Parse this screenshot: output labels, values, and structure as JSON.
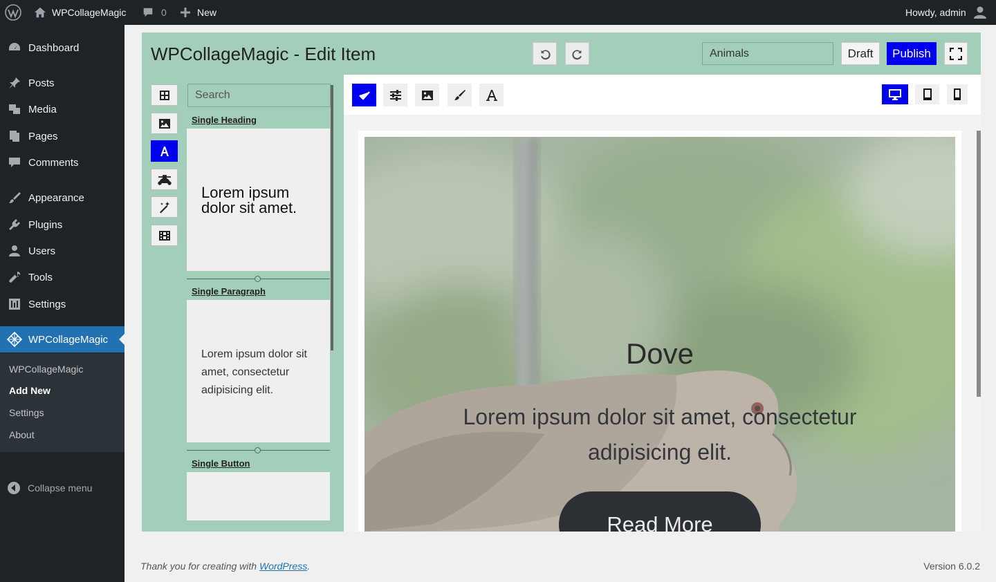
{
  "adminbar": {
    "site_name": "WPCollageMagic",
    "comments_count": "0",
    "new_label": "New",
    "greeting": "Howdy, admin"
  },
  "sidebar": {
    "items": [
      {
        "label": "Dashboard",
        "icon": "dashboard-icon"
      },
      {
        "label": "Posts",
        "icon": "pin-icon"
      },
      {
        "label": "Media",
        "icon": "media-icon"
      },
      {
        "label": "Pages",
        "icon": "pages-icon"
      },
      {
        "label": "Comments",
        "icon": "comment-icon"
      },
      {
        "label": "Appearance",
        "icon": "brush-icon"
      },
      {
        "label": "Plugins",
        "icon": "plug-icon"
      },
      {
        "label": "Users",
        "icon": "user-icon"
      },
      {
        "label": "Tools",
        "icon": "wrench-icon"
      },
      {
        "label": "Settings",
        "icon": "settings-icon"
      },
      {
        "label": "WPCollageMagic",
        "icon": "collage-icon",
        "active": true
      }
    ],
    "submenu": [
      "WPCollageMagic",
      "Add New",
      "Settings",
      "About"
    ],
    "current_submenu": "Add New",
    "collapse_label": "Collapse menu"
  },
  "editor": {
    "title": "WPCollageMagic - Edit Item",
    "category_value": "Animals",
    "draft_label": "Draft",
    "publish_label": "Publish",
    "search_placeholder": "Search",
    "library": [
      {
        "label": "Single Heading",
        "preview": "Lorem ipsum dolor sit amet."
      },
      {
        "label": "Single Paragraph",
        "preview": "Lorem ipsum dolor sit amet, consectetur adipisicing elit."
      },
      {
        "label": "Single Button",
        "preview": ""
      }
    ]
  },
  "canvas": {
    "heading": "Dove",
    "paragraph": "Lorem ipsum dolor sit amet, consectetur adipisicing elit.",
    "button": "Read More"
  },
  "footer": {
    "thanks_prefix": "Thank you for creating with ",
    "thanks_link": "WordPress",
    "thanks_suffix": ".",
    "version": "Version 6.0.2"
  },
  "colors": {
    "admin_dark": "#1d2327",
    "wp_blue": "#2271b1",
    "editor_green": "#a3ceba",
    "accent_blue": "#0000f0"
  }
}
